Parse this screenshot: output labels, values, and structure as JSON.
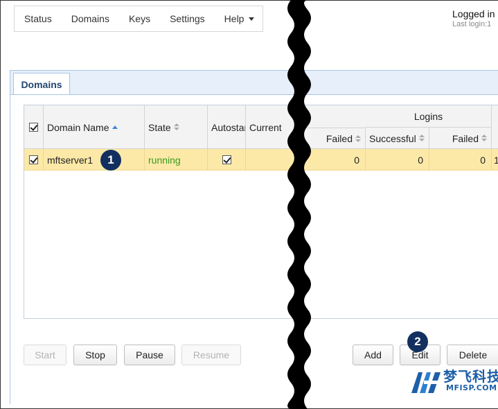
{
  "nav": {
    "items": [
      "Status",
      "Domains",
      "Keys",
      "Settings",
      "Help"
    ]
  },
  "session": {
    "logged_in": "Logged in",
    "last_login": "Last login:1"
  },
  "tab": {
    "label": "Domains"
  },
  "grid": {
    "headers": {
      "domain_name": "Domain Name",
      "state": "State",
      "autostart": "Autostar",
      "current": "Current",
      "failed_1": "Failed",
      "logins_group": "Logins",
      "successful": "Successful",
      "failed_2": "Failed"
    },
    "rows": [
      {
        "selected": true,
        "domain_name": "mftserver1",
        "state": "running",
        "autostart": true,
        "failed_1": "0",
        "successful": "0",
        "failed_2": "0",
        "extra": "1"
      }
    ]
  },
  "buttons": {
    "start": "Start",
    "stop": "Stop",
    "pause": "Pause",
    "resume": "Resume",
    "add": "Add",
    "edit": "Edit",
    "delete": "Delete"
  },
  "callouts": [
    "1",
    "2"
  ],
  "watermark": {
    "cn": "梦飞科技",
    "en": "MFISP.COM"
  },
  "colors": {
    "accent": "#23456e",
    "selected_row": "#fce9a7",
    "running": "#3a9a1d",
    "callout": "#12305f",
    "panel": "#e6effa"
  }
}
